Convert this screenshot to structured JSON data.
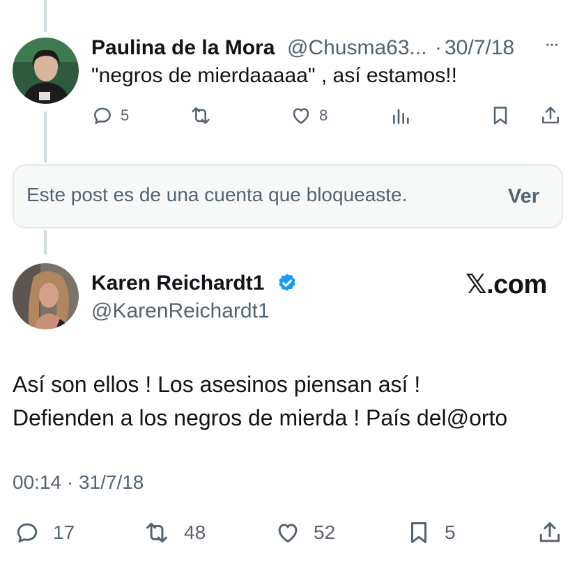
{
  "reply_tweet": {
    "author_name": "Paulina de la Mora",
    "author_handle": "@Chusma63...",
    "separator": "·",
    "date": "30/7/18",
    "text": "\"negros de mierdaaaaa\" , así estamos!!",
    "metrics": {
      "replies": "5",
      "likes": "8"
    },
    "icons": [
      "reply-icon",
      "retweet-icon",
      "like-icon",
      "views-icon",
      "bookmark-icon",
      "share-icon",
      "more-icon"
    ]
  },
  "blocked_notice": {
    "text": "Este post es de una cuenta que bloqueaste.",
    "button_label": "Ver"
  },
  "main_tweet": {
    "author_name": "Karen Reichardt1",
    "author_handle": "@KarenReichardt1",
    "verified": true,
    "watermark": "𝕏.com",
    "text_line_1": "Así son ellos ! Los asesinos piensan así !",
    "text_line_2": "Defienden a los negros de mierda ! País del@orto",
    "timestamp": "00:14 · 31/7/18",
    "metrics": {
      "replies": "17",
      "retweets": "48",
      "likes": "52",
      "bookmarks": "5"
    }
  },
  "colors": {
    "text": "#0f1419",
    "muted": "#536471",
    "verified_blue": "#1d9bf0",
    "thread_line": "#cfd9de"
  }
}
